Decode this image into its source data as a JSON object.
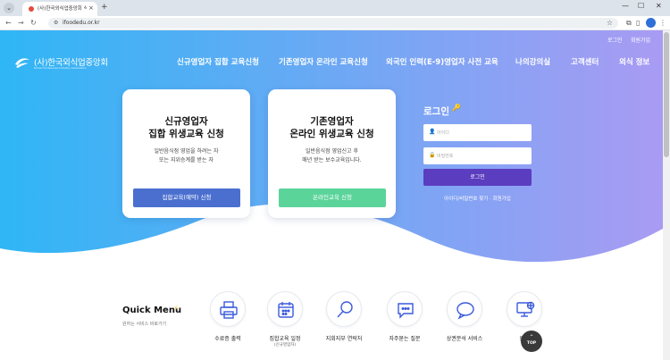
{
  "browser": {
    "tab_title": "(사)한국외식업중앙회 식품위생교육",
    "url": "ifoodedu.or.kr",
    "tab_close": "×",
    "new_tab": "+",
    "minimize": "—",
    "maximize": "☐",
    "close": "✕"
  },
  "header": {
    "util_login": "로그인",
    "util_signup": "회원가입",
    "logo_text": "(사)한국외식업중앙회",
    "logo_sub": "Korea Foodservice Industry Association",
    "nav": [
      "신규영업자 집합 교육신청",
      "기존영업자 온라인 교육신청",
      "외국인 인력(E-9)영업자 사전 교육",
      "나의강의실",
      "고객센터",
      "외식 정보"
    ]
  },
  "cards": [
    {
      "title1": "신규영업자",
      "title2": "집합 위생교육 신청",
      "desc1": "일반음식점 영업을 하려는 자",
      "desc2": "또는 지위승계를 받는 자",
      "button": "집합교육(예약) 신청",
      "color": "#4a6fcf"
    },
    {
      "title1": "기존영업자",
      "title2": "온라인 위생교육 신청",
      "desc1": "일반음식점 영업신고 후",
      "desc2": "매년 받는 보수교육입니다.",
      "button": "온라인교육 신청",
      "color": "#5bd49a"
    }
  ],
  "login": {
    "title": "로그인",
    "id_placeholder": "아이디",
    "pw_placeholder": "비밀번호",
    "button": "로그인",
    "links": "아이디/비밀번호 찾기 · 회원가입"
  },
  "quick_menu": {
    "title": "Quick Menu",
    "subtitle": "원하는 서비스 바로가기",
    "items": [
      {
        "label": "수료증 출력",
        "sub": "",
        "icon": "printer-icon"
      },
      {
        "label": "집합교육 일정",
        "sub": "(신규영업자)",
        "icon": "calendar-icon"
      },
      {
        "label": "지회지부 연락처",
        "sub": "",
        "icon": "search-icon"
      },
      {
        "label": "자주묻는 질문",
        "sub": "",
        "icon": "chat-bubble-icon"
      },
      {
        "label": "상권분석 서비스",
        "sub": "",
        "icon": "speech-bubble-icon"
      },
      {
        "label": "원격",
        "sub": "",
        "icon": "monitor-icon"
      }
    ]
  },
  "top_button": {
    "arrow": "⌃",
    "label": "TOP"
  },
  "colors": {
    "hero_left": "#2fb6f5",
    "hero_right": "#a99bf3",
    "login_button": "#5b3dbf"
  }
}
